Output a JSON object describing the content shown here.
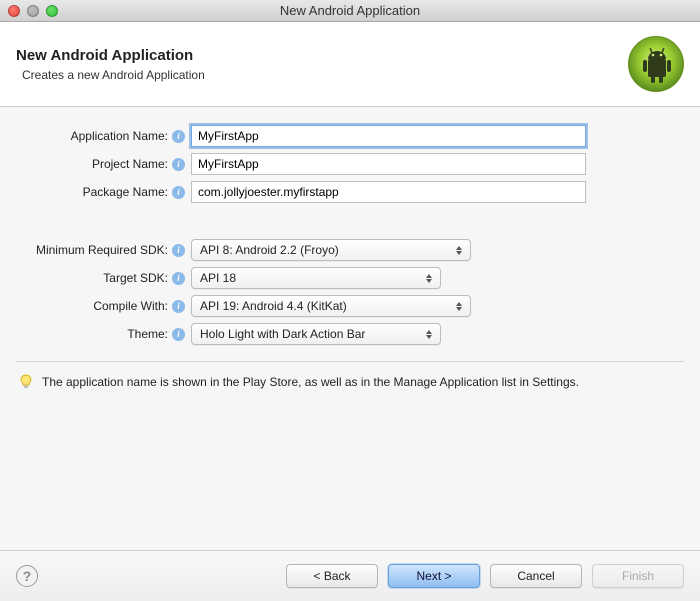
{
  "window": {
    "title": "New Android Application"
  },
  "header": {
    "title": "New Android Application",
    "subtitle": "Creates a new Android Application"
  },
  "form": {
    "application_name": {
      "label": "Application Name:",
      "value": "MyFirstApp"
    },
    "project_name": {
      "label": "Project Name:",
      "value": "MyFirstApp"
    },
    "package_name": {
      "label": "Package Name:",
      "value": "com.jollyjoester.myfirstapp"
    },
    "min_sdk": {
      "label": "Minimum Required SDK:",
      "value": "API 8: Android 2.2 (Froyo)"
    },
    "target_sdk": {
      "label": "Target SDK:",
      "value": "API 18"
    },
    "compile_with": {
      "label": "Compile With:",
      "value": "API 19: Android 4.4 (KitKat)"
    },
    "theme": {
      "label": "Theme:",
      "value": "Holo Light with Dark Action Bar"
    }
  },
  "hint": {
    "text": "The application name is shown in the Play Store, as well as in the Manage Application list in Settings."
  },
  "footer": {
    "back": "< Back",
    "next": "Next >",
    "cancel": "Cancel",
    "finish": "Finish"
  }
}
